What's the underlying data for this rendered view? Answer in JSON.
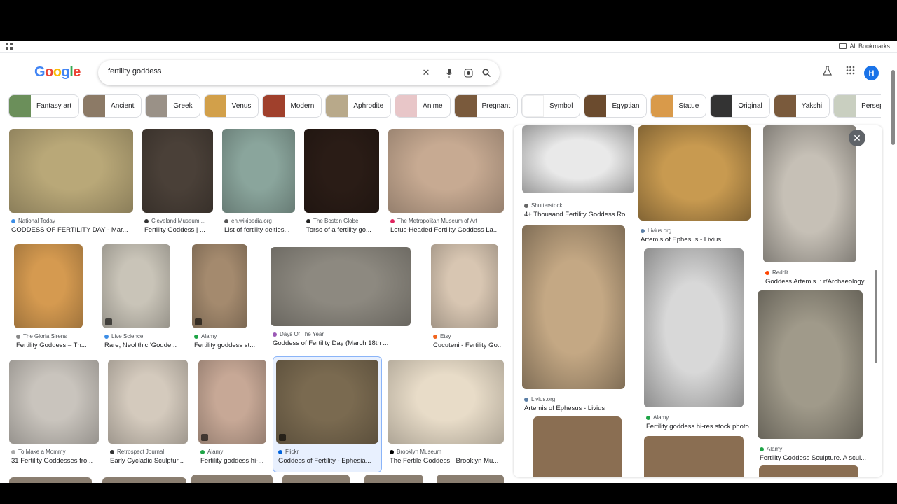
{
  "browser": {
    "bookmarks_label": "All Bookmarks"
  },
  "search": {
    "query": "fertility goddess",
    "user_initial": "H"
  },
  "chips": [
    {
      "label": "Fantasy art",
      "color": "#6b8f5a"
    },
    {
      "label": "Ancient",
      "color": "#8c7a66"
    },
    {
      "label": "Greek",
      "color": "#9a9187"
    },
    {
      "label": "Venus",
      "color": "#d2a04a"
    },
    {
      "label": "Modern",
      "color": "#a0402c"
    },
    {
      "label": "Aphrodite",
      "color": "#b8a98a"
    },
    {
      "label": "Anime",
      "color": "#e8c6c8"
    },
    {
      "label": "Pregnant",
      "color": "#7a5a3c"
    },
    {
      "label": "Symbol",
      "color": "#ffffff"
    },
    {
      "label": "Egyptian",
      "color": "#6b4b2e"
    },
    {
      "label": "Statue",
      "color": "#d99a4a"
    },
    {
      "label": "Original",
      "color": "#333333"
    },
    {
      "label": "Yakshi",
      "color": "#7a5a3c"
    },
    {
      "label": "Persephone",
      "color": "#c9cfc0"
    }
  ],
  "results": [
    {
      "source": "National Today",
      "title": "GODDESS OF FERTILITY DAY - Mar...",
      "color": "#b9a878",
      "fav": "#3d8ee6"
    },
    {
      "source": "Cleveland Museum ...",
      "title": "Fertility Goddess | ...",
      "color": "#4a4038",
      "fav": "#333333"
    },
    {
      "source": "en.wikipedia.org",
      "title": "List of fertility deities...",
      "color": "#8aa59c",
      "fav": "#555555"
    },
    {
      "source": "The Boston Globe",
      "title": "Torso of a fertility go...",
      "color": "#2a1c16",
      "fav": "#222222"
    },
    {
      "source": "The Metropolitan Museum of Art",
      "title": "Lotus-Headed Fertility Goddess La...",
      "color": "#c7aa92",
      "fav": "#e0245e"
    },
    {
      "source": "The Gloria Sirens",
      "title": "Fertility Goddess – Th...",
      "color": "#d59a50",
      "fav": "#888888"
    },
    {
      "source": "Live Science",
      "title": "Rare, Neolithic 'Godde...",
      "color": "#c9c4b8",
      "fav": "#3d8ee6"
    },
    {
      "source": "Alamy",
      "title": "Fertility goddess st...",
      "color": "#a48a6e",
      "fav": "#1ea446"
    },
    {
      "source": "Days Of The Year",
      "title": "Goddess of Fertility Day (March 18th ...",
      "color": "#8d8980",
      "fav": "#9b59b6"
    },
    {
      "source": "Etsy",
      "title": "Cucuteni - Fertility Go...",
      "color": "#d8c6b2",
      "fav": "#f1641e"
    },
    {
      "source": "To Make a Mommy",
      "title": "31 Fertility Goddesses fro...",
      "color": "#c9c4bd",
      "fav": "#aaaaaa"
    },
    {
      "source": "Retrospect Journal",
      "title": "Early Cycladic Sculptur...",
      "color": "#d4cabd",
      "fav": "#333333"
    },
    {
      "source": "Alamy",
      "title": "Fertility goddess hi-...",
      "color": "#c7a896",
      "fav": "#1ea446"
    },
    {
      "source": "Flickr",
      "title": "Goddess of Fertility - Ephesia...",
      "color": "#7a6a50",
      "fav": "#0063dc"
    },
    {
      "source": "Brooklyn Museum",
      "title": "The Fertile Goddess · Brooklyn Mu...",
      "color": "#e8dcc8",
      "fav": "#000000"
    }
  ],
  "panel": {
    "close_label": "✕",
    "items": [
      {
        "source": "Shutterstock",
        "title": "4+ Thousand Fertility Goddess Ro...",
        "color": "#e9e9e9",
        "fav": "#666666"
      },
      {
        "source": "Livius.org",
        "title": "Artemis of Ephesus - Livius",
        "color": "#c89a50",
        "fav": "#5b7fa6"
      },
      {
        "source": "Reddit",
        "title": "Goddess Artemis. : r/Archaeology",
        "color": "#c6c0b6",
        "fav": "#ff4500"
      },
      {
        "source": "Livius.org",
        "title": "Artemis of Ephesus - Livius",
        "color": "#c4a884",
        "fav": "#5b7fa6"
      },
      {
        "source": "Alamy",
        "title": "Fertility goddess hi-res stock photo...",
        "color": "#d8d8d8",
        "fav": "#1ea446"
      },
      {
        "source": "Alamy",
        "title": "Fertility Goddess Sculpture. A scul...",
        "color": "#a09a8a",
        "fav": "#1ea446"
      }
    ]
  }
}
